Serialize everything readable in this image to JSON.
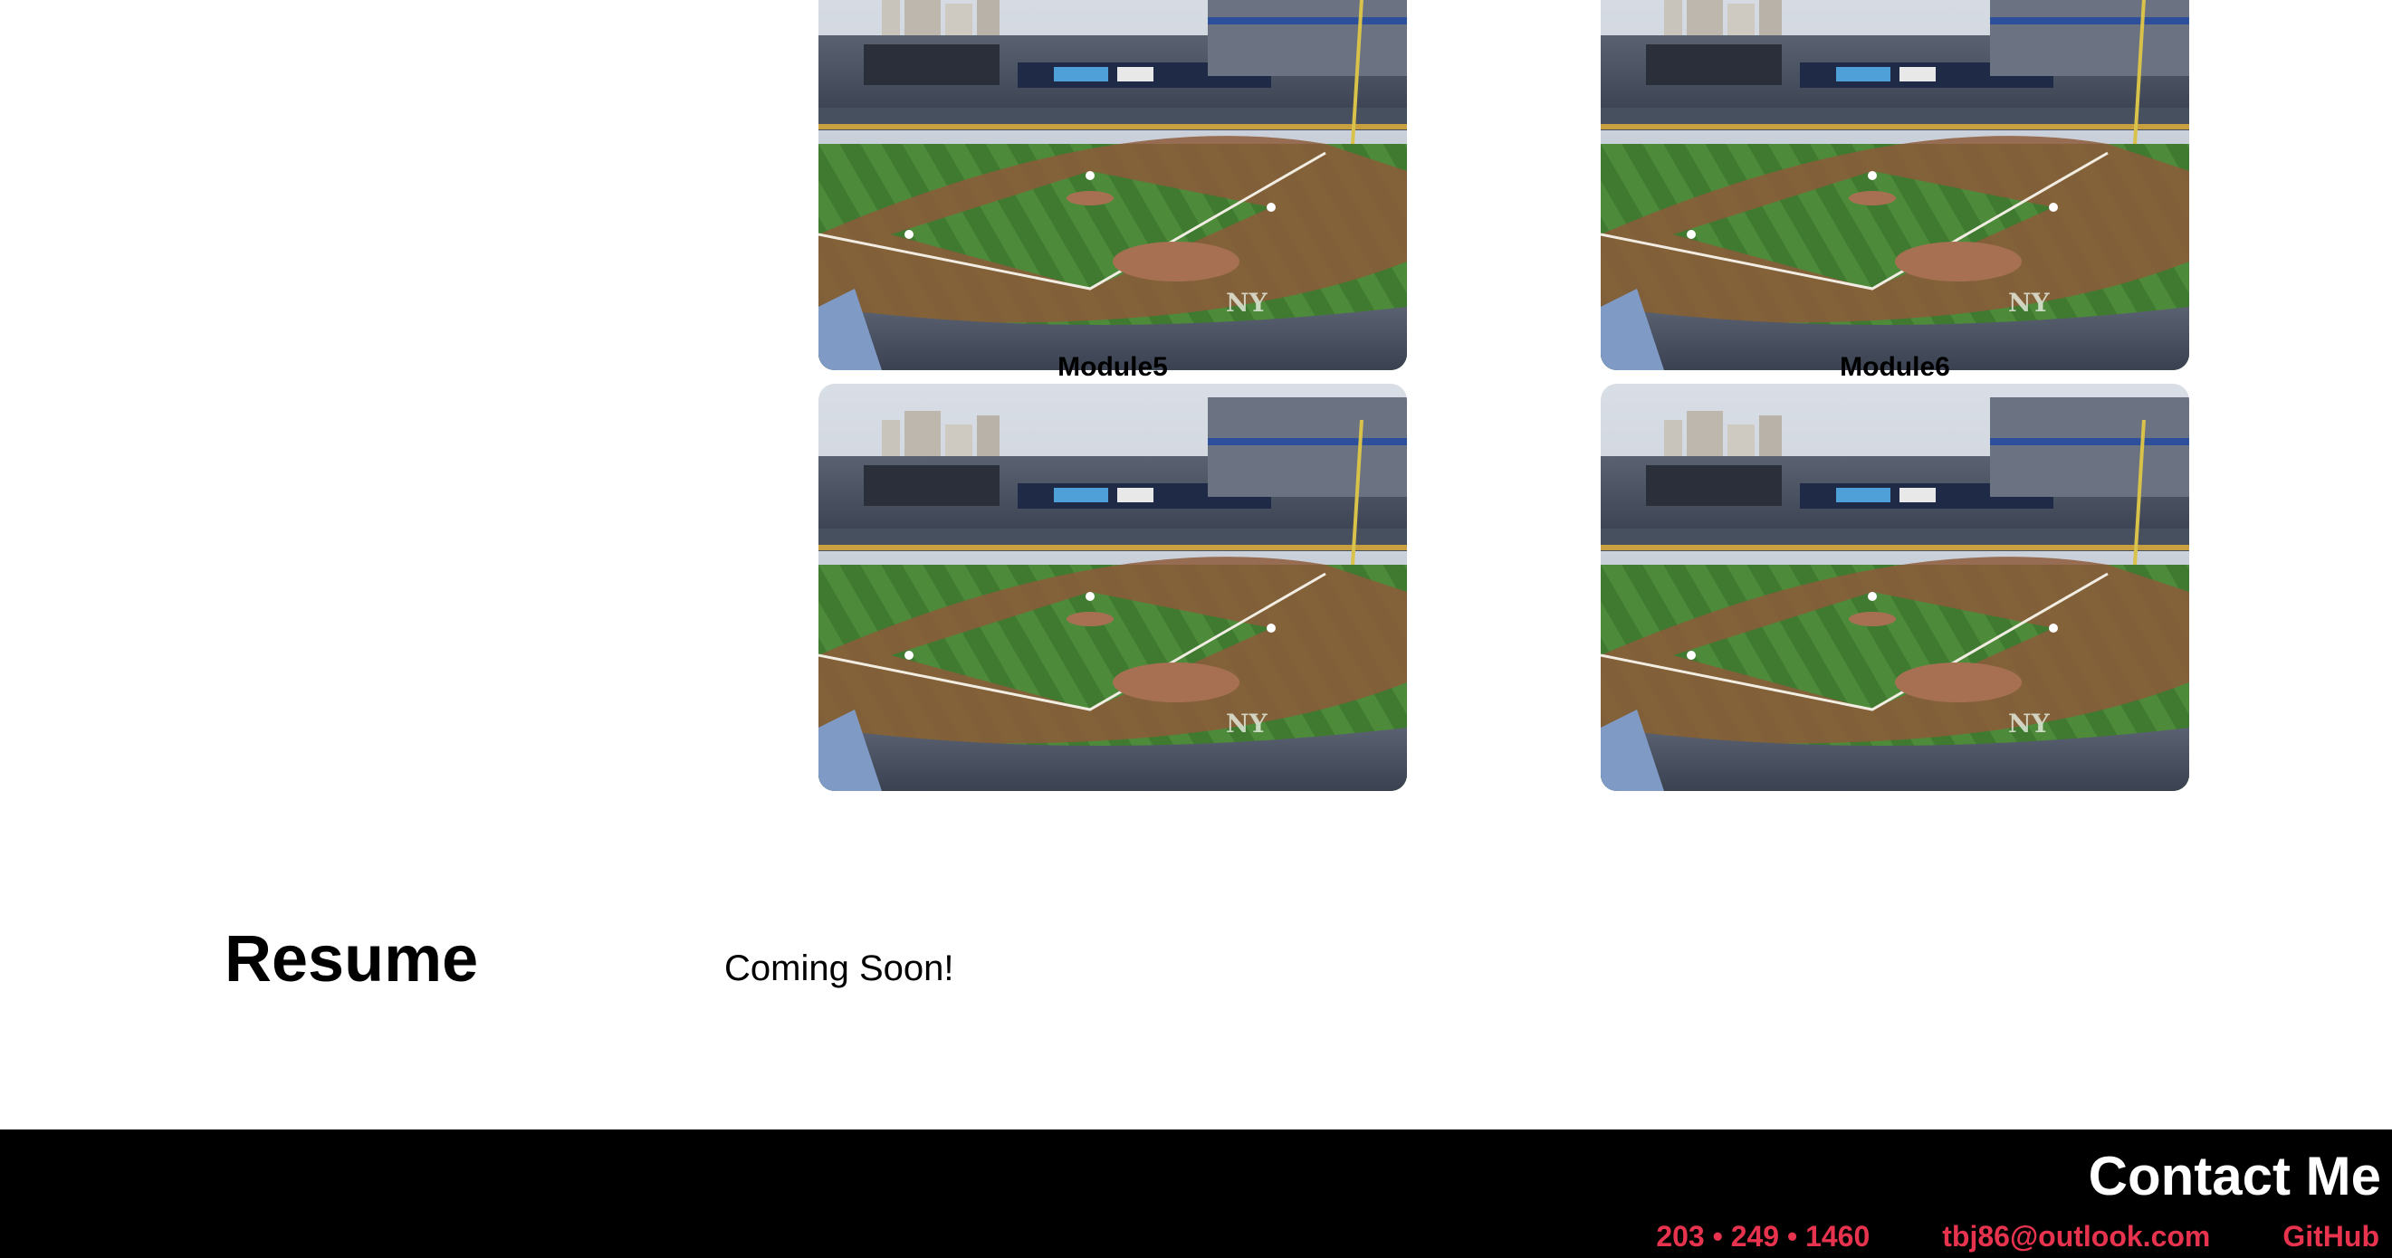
{
  "modules": {
    "items": [
      {
        "caption": ""
      },
      {
        "caption": ""
      },
      {
        "caption": "Module5"
      },
      {
        "caption": "Module6"
      }
    ],
    "image_alt": "Baseball stadium photo"
  },
  "resume": {
    "title": "Resume",
    "text": "Coming Soon!"
  },
  "footer": {
    "title": "Contact Me",
    "phone": "203 • 249 • 1460",
    "email": "tbj86@outlook.com",
    "github": "GitHub"
  },
  "colors": {
    "accent": "#e8334f",
    "footer_bg": "#000000"
  }
}
